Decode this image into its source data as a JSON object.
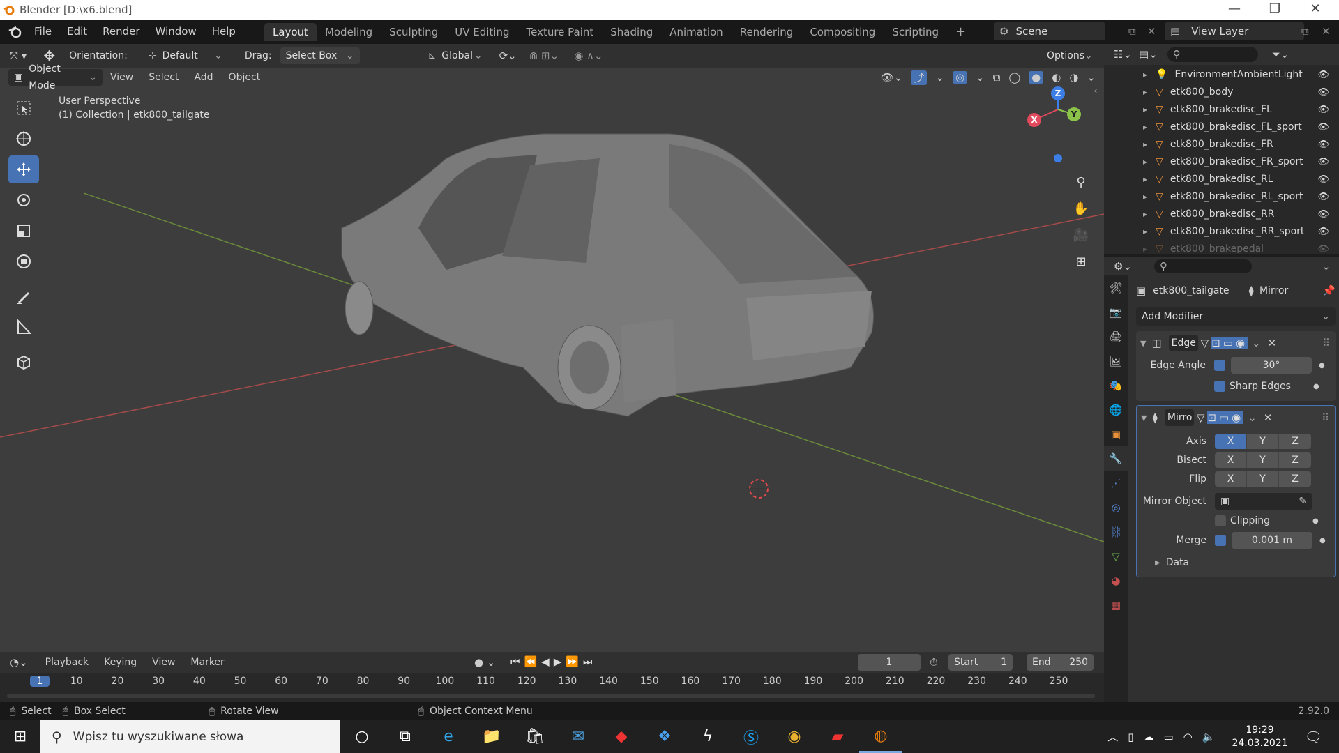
{
  "window": {
    "title": "Blender [D:\\x6.blend]",
    "minimize": "—",
    "maximize": "❐",
    "close": "✕"
  },
  "menu": [
    "File",
    "Edit",
    "Render",
    "Window",
    "Help"
  ],
  "workspaces": [
    "Layout",
    "Modeling",
    "Sculpting",
    "UV Editing",
    "Texture Paint",
    "Shading",
    "Animation",
    "Rendering",
    "Compositing",
    "Scripting"
  ],
  "workspace_add": "+",
  "scene": {
    "label": "Scene",
    "view_layer": "View Layer"
  },
  "tool_header": {
    "orientation_label": "Orientation:",
    "orientation_value": "Default",
    "drag_label": "Drag:",
    "drag_value": "Select Box",
    "transform_orientation": "Global",
    "options": "Options"
  },
  "viewport_header": {
    "mode": "Object Mode",
    "menus": [
      "View",
      "Select",
      "Add",
      "Object"
    ]
  },
  "viewport": {
    "perspective": "User Perspective",
    "collection": "(1) Collection | etk800_tailgate",
    "gizmo": {
      "x": "X",
      "y": "Y",
      "z": "Z"
    }
  },
  "outliner": {
    "items": [
      {
        "name": "EnvironmentAmbientLight",
        "type": "light"
      },
      {
        "name": "etk800_body",
        "type": "mesh"
      },
      {
        "name": "etk800_brakedisc_FL",
        "type": "mesh"
      },
      {
        "name": "etk800_brakedisc_FL_sport",
        "type": "mesh"
      },
      {
        "name": "etk800_brakedisc_FR",
        "type": "mesh"
      },
      {
        "name": "etk800_brakedisc_FR_sport",
        "type": "mesh"
      },
      {
        "name": "etk800_brakedisc_RL",
        "type": "mesh"
      },
      {
        "name": "etk800_brakedisc_RL_sport",
        "type": "mesh"
      },
      {
        "name": "etk800_brakedisc_RR",
        "type": "mesh"
      },
      {
        "name": "etk800_brakedisc_RR_sport",
        "type": "mesh"
      },
      {
        "name": "etk800_brakepedal",
        "type": "mesh"
      }
    ]
  },
  "properties": {
    "object_name": "etk800_tailgate",
    "modifier_label": "Mirror",
    "add_modifier": "Add Modifier",
    "edge_modifier": {
      "name": "Edge",
      "edge_angle_label": "Edge Angle",
      "edge_angle_value": "30°",
      "sharp_edges_label": "Sharp Edges"
    },
    "mirror_modifier": {
      "name": "Mirro",
      "axis_label": "Axis",
      "bisect_label": "Bisect",
      "flip_label": "Flip",
      "axes": [
        "X",
        "Y",
        "Z"
      ],
      "mirror_object_label": "Mirror Object",
      "clipping_label": "Clipping",
      "merge_label": "Merge",
      "merge_value": "0.001 m",
      "data_label": "Data"
    }
  },
  "timeline": {
    "menus": [
      "Playback",
      "Keying",
      "View",
      "Marker"
    ],
    "current_frame": "1",
    "start_label": "Start",
    "start_value": "1",
    "end_label": "End",
    "end_value": "250",
    "ticks": [
      "1",
      "10",
      "20",
      "30",
      "40",
      "50",
      "60",
      "70",
      "80",
      "90",
      "100",
      "110",
      "120",
      "130",
      "140",
      "150",
      "160",
      "170",
      "180",
      "190",
      "200",
      "210",
      "220",
      "230",
      "240",
      "250"
    ]
  },
  "statusbar": {
    "select": "Select",
    "box_select": "Box Select",
    "rotate_view": "Rotate View",
    "context_menu": "Object Context Menu",
    "version": "2.92.0"
  },
  "taskbar": {
    "search_placeholder": "Wpisz tu wyszukiwane słowa",
    "time": "19:29",
    "date": "24.03.2021"
  },
  "colors": {
    "accent": "#4772b3",
    "x_axis": "#e04a5c",
    "y_axis": "#8bc34a",
    "z_axis": "#3c7ee6",
    "mesh_icon": "#e8913a"
  }
}
